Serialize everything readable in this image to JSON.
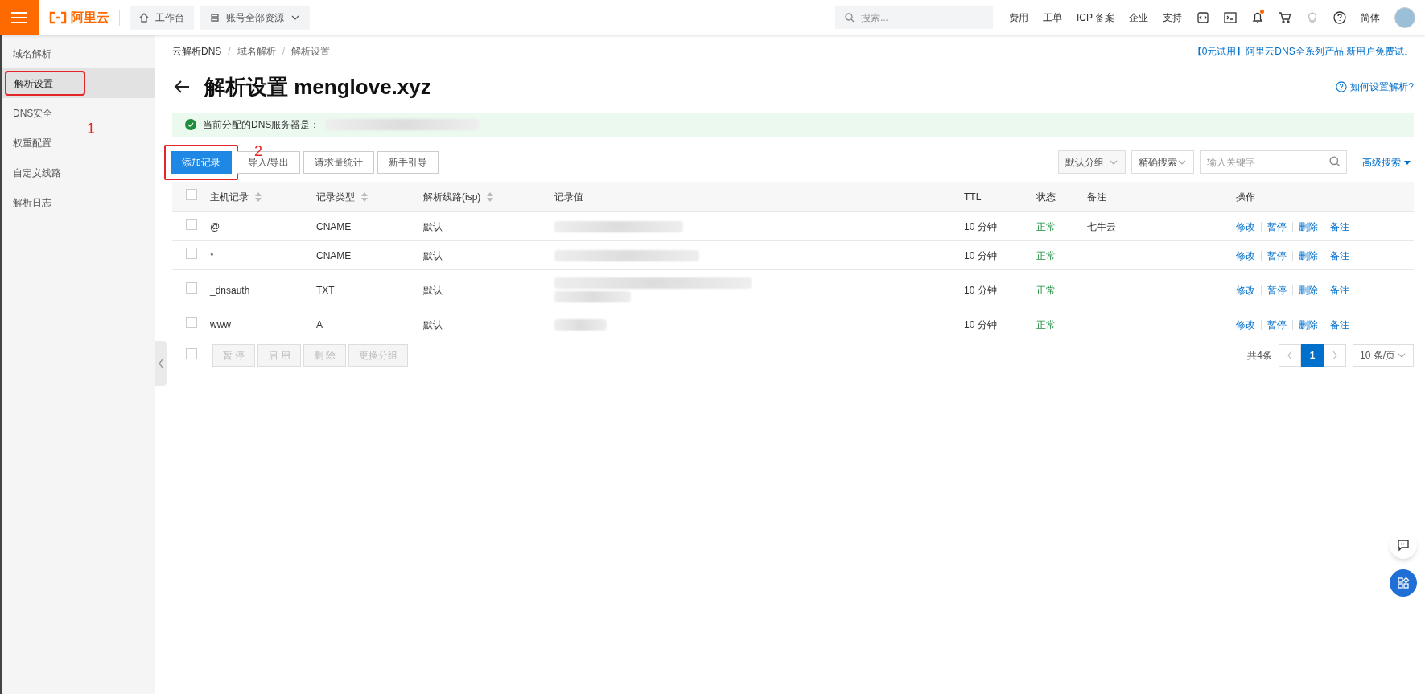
{
  "topbar": {
    "logo": "阿里云",
    "workbench": "工作台",
    "resources": "账号全部资源",
    "search_placeholder": "搜索...",
    "links": [
      "费用",
      "工单",
      "ICP 备案",
      "企业",
      "支持"
    ],
    "notification_dot": true,
    "language": "简体"
  },
  "sidebar": {
    "items": [
      {
        "label": "域名解析",
        "selected": false,
        "highlighted": false
      },
      {
        "label": "解析设置",
        "selected": true,
        "highlighted": true
      },
      {
        "label": "DNS安全",
        "selected": false,
        "highlighted": false
      },
      {
        "label": "权重配置",
        "selected": false,
        "highlighted": false
      },
      {
        "label": "自定义线路",
        "selected": false,
        "highlighted": false
      },
      {
        "label": "解析日志",
        "selected": false,
        "highlighted": false
      }
    ],
    "annotation": "1"
  },
  "breadcrumb": [
    {
      "label": "云解析DNS"
    },
    {
      "separator": "/",
      "label": "域名解析"
    },
    {
      "separator": "/",
      "label": "解析设置"
    }
  ],
  "promo": "【0元试用】阿里云DNS全系列产品 新用户免费试。",
  "title": "解析设置 menglove.xyz",
  "help_link": "如何设置解析?",
  "notice": {
    "text": "当前分配的DNS服务器是：",
    "value_redacted": true
  },
  "toolbar": {
    "buttons": [
      {
        "label": "添加记录",
        "kind": "primary",
        "highlighted": true
      },
      {
        "label": "导入/导出",
        "kind": "default",
        "highlighted": false
      },
      {
        "label": "请求量统计",
        "kind": "default",
        "highlighted": false
      },
      {
        "label": "新手引导",
        "kind": "default",
        "highlighted": false
      }
    ],
    "annotation": "2",
    "group_select": "默认分组",
    "mode_select": "精确搜索",
    "keyword_placeholder": "输入关键字",
    "advanced": "高级搜索"
  },
  "table": {
    "select_all_checked": false,
    "columns": [
      {
        "label": "主机记录",
        "sortable": true
      },
      {
        "label": "记录类型",
        "sortable": true
      },
      {
        "label": "解析线路(isp)",
        "sortable": true
      },
      {
        "label": "记录值",
        "sortable": false
      },
      {
        "label": "TTL",
        "sortable": false
      },
      {
        "label": "状态",
        "sortable": false
      },
      {
        "label": "备注",
        "sortable": false
      },
      {
        "label": "操作",
        "sortable": false
      }
    ],
    "rows": [
      {
        "checked": false,
        "host": "@",
        "type": "CNAME",
        "line": "默认",
        "value_redacted": true,
        "ttl": "10 分钟",
        "status": "正常",
        "note": "七牛云",
        "actions": [
          "修改",
          "暂停",
          "删除",
          "备注"
        ]
      },
      {
        "checked": false,
        "host": "*",
        "type": "CNAME",
        "line": "默认",
        "value_redacted": true,
        "ttl": "10 分钟",
        "status": "正常",
        "actions": [
          "修改",
          "暂停",
          "删除",
          "备注"
        ]
      },
      {
        "checked": false,
        "host": "_dnsauth",
        "type": "TXT",
        "line": "默认",
        "value_redacted": true,
        "ttl": "10 分钟",
        "status": "正常",
        "actions": [
          "修改",
          "暂停",
          "删除",
          "备注"
        ]
      },
      {
        "checked": false,
        "host": "www",
        "type": "A",
        "line": "默认",
        "value_redacted": true,
        "ttl": "10 分钟",
        "status": "正常",
        "actions": [
          "修改",
          "暂停",
          "删除",
          "备注"
        ]
      }
    ],
    "bulk_select_checked": false,
    "bulk_actions": [
      {
        "label": "暂 停",
        "disabled": true
      },
      {
        "label": "启 用",
        "disabled": true
      },
      {
        "label": "删 除",
        "disabled": true
      },
      {
        "label": "更换分组",
        "disabled": true
      }
    ],
    "total": "共4条",
    "pages": [
      {
        "label": "1",
        "selected": true
      }
    ],
    "page_size": "10 条/页"
  }
}
